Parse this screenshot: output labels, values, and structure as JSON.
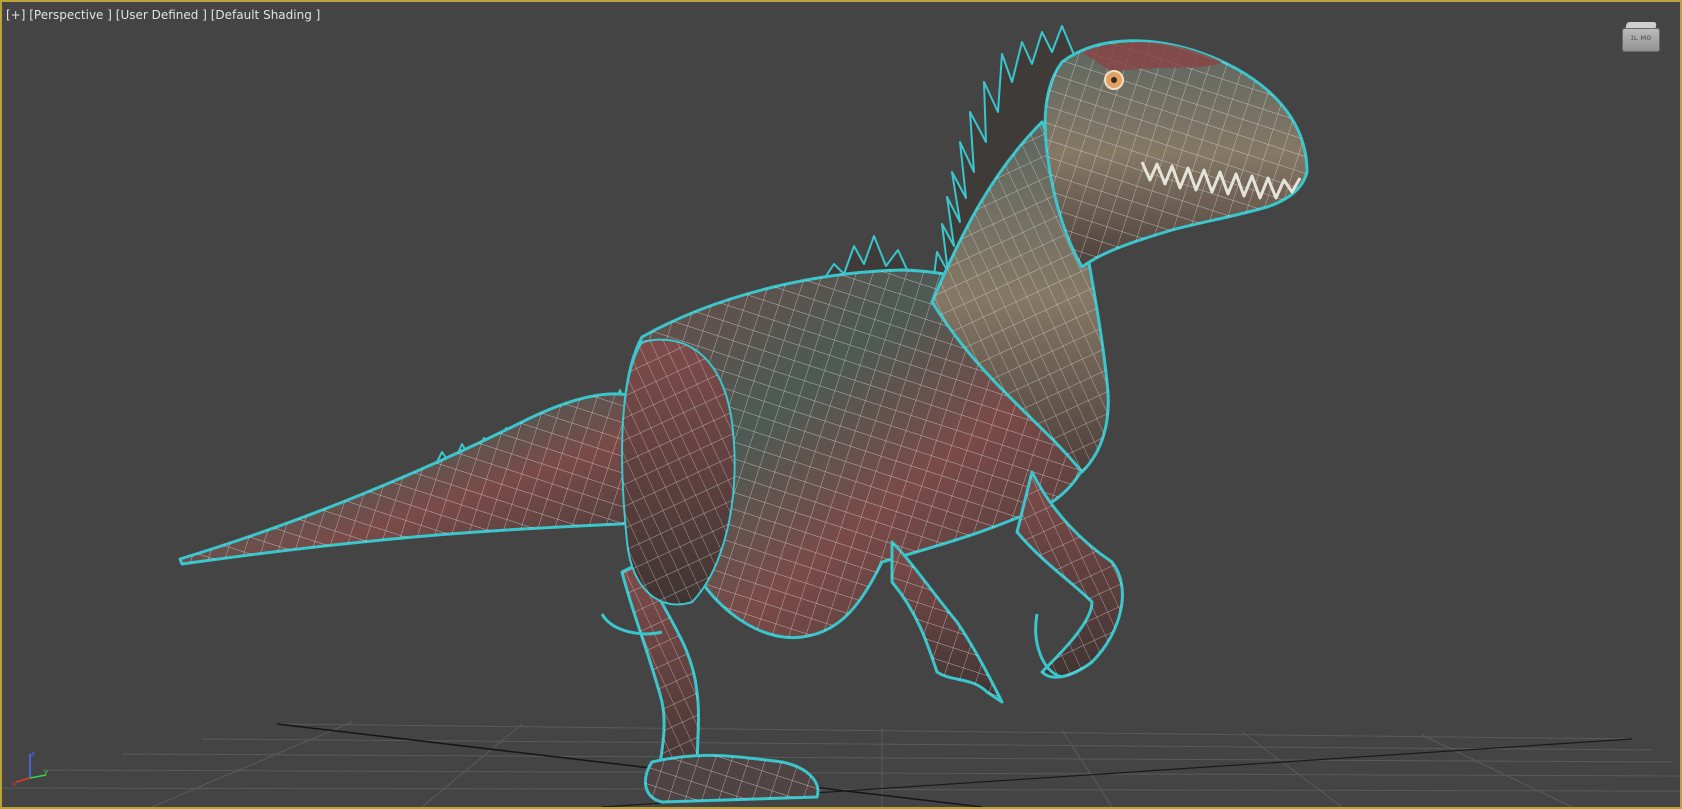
{
  "viewport": {
    "labels": [
      "[+]",
      "[Perspective ]",
      "[User Defined ]",
      "[Default Shading ]"
    ],
    "border_color": "#b9a338",
    "background_color": "#444444"
  },
  "viewcube": {
    "icon": "viewcube-icon",
    "face_text": "ɪʟ ᴍᴏ"
  },
  "axis_tripod": {
    "icon": "axis-tripod-icon",
    "x_color": "#e03a3a",
    "y_color": "#3ad04a",
    "z_color": "#4a6cff"
  },
  "model": {
    "icon": "dinosaur-model-icon",
    "selection_outline_color": "#39c6cc",
    "wire_color": "#e8e8e8"
  }
}
